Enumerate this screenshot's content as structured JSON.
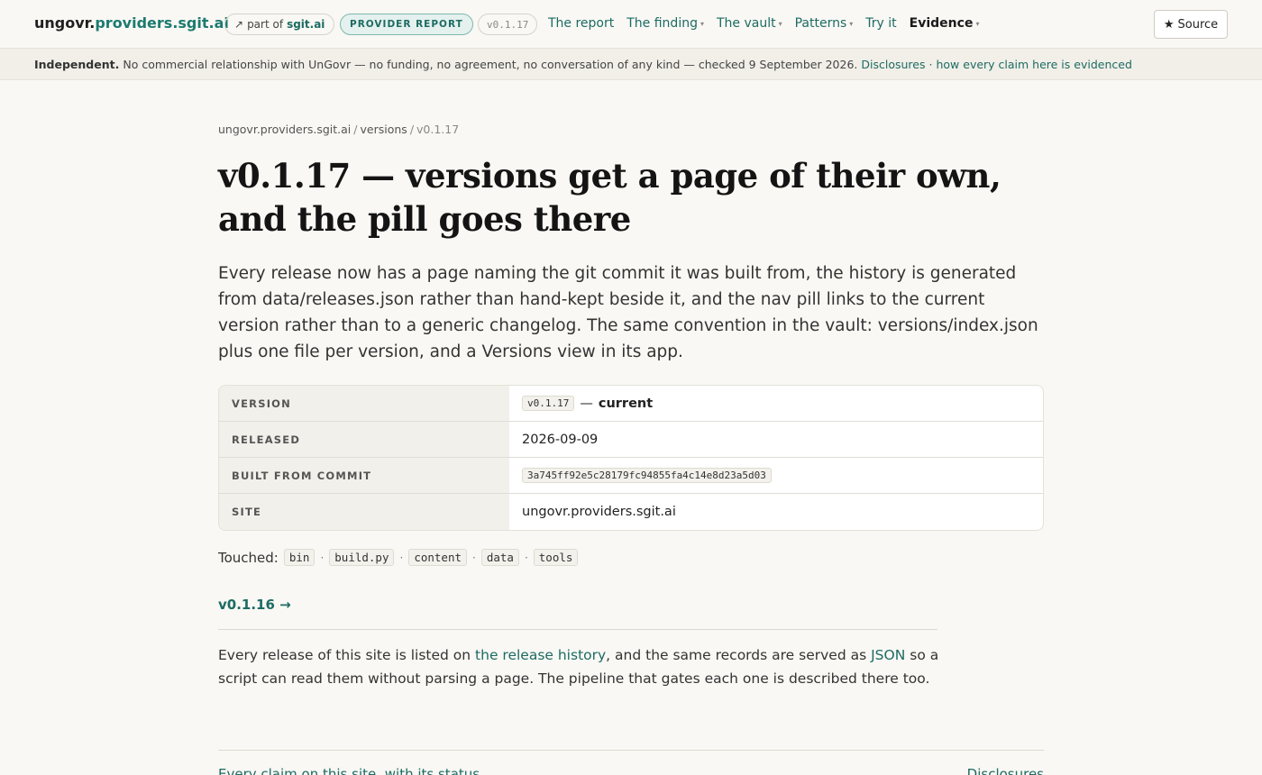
{
  "header": {
    "brand_prefix": "ungovr.",
    "brand_accent": "providers.sgit.ai",
    "part_of_label": "part of",
    "part_of_site": "sgit.ai",
    "part_of_arrow": "↗",
    "report_pill": "PROVIDER REPORT",
    "version_pill": "v0.1.17",
    "nav": [
      {
        "label": "The report",
        "caret": false
      },
      {
        "label": "The finding",
        "caret": true
      },
      {
        "label": "The vault",
        "caret": true
      },
      {
        "label": "Patterns",
        "caret": true
      },
      {
        "label": "Try it",
        "caret": false
      },
      {
        "label": "Evidence",
        "caret": true,
        "active": true
      }
    ],
    "caret_glyph": "▾",
    "source_icon": "★",
    "source_label": "Source"
  },
  "banner": {
    "bold": "Independent.",
    "text": "No commercial relationship with UnGovr — no funding, no agreement, no conversation of any kind — checked 9 September 2026.",
    "link1": "Disclosures",
    "separator": "·",
    "link2": "how every claim here is evidenced"
  },
  "breadcrumb": {
    "home": "ungovr.providers.sgit.ai",
    "sep": "/",
    "section": "versions",
    "current": "v0.1.17"
  },
  "page": {
    "title": "v0.1.17 — versions get a page of their own, and the pill goes there",
    "lede": "Every release now has a page naming the git commit it was built from, the history is generated from data/releases.json rather than hand-kept beside it, and the nav pill links to the current version rather than to a generic changelog. The same convention in the vault: versions/index.json plus one file per version, and a Versions view in its app."
  },
  "meta": {
    "version_key": "VERSION",
    "version_value": "v0.1.17",
    "version_dash": "—",
    "version_status": "current",
    "released_key": "RELEASED",
    "released_value": "2026-09-09",
    "commit_key": "BUILT FROM COMMIT",
    "commit_value": "3a745ff92e5c28179fc94855fa4c14e8d23a5d03",
    "site_key": "SITE",
    "site_value": "ungovr.providers.sgit.ai"
  },
  "touched": {
    "label": "Touched:",
    "items": [
      "bin",
      "build.py",
      "content",
      "data",
      "tools"
    ],
    "separator": "·"
  },
  "nav_links": {
    "next": "v0.1.16 →"
  },
  "footnote": {
    "part1": "Every release of this site is listed on",
    "link1": "the release history",
    "part2": ", and the same records are served as",
    "link2": "JSON",
    "part3": "so a script can read them without parsing a page. The pipeline that gates each one is described there too."
  },
  "footer": {
    "left": "Every claim on this site, with its status",
    "right": "Disclosures"
  }
}
